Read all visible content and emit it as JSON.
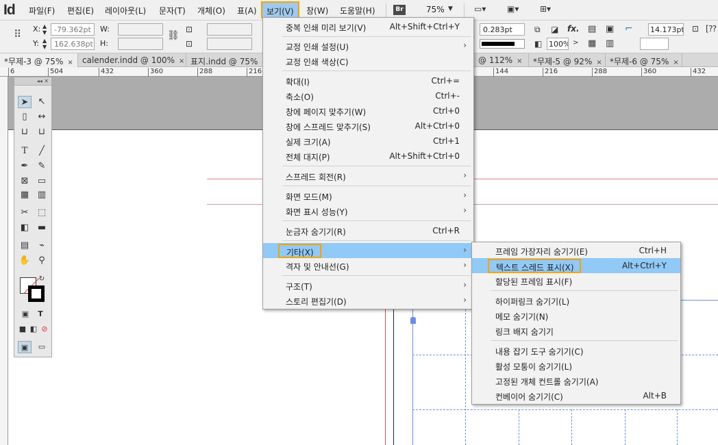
{
  "app": {
    "logo": "Id"
  },
  "menubar": {
    "items": [
      "파일(F)",
      "편집(E)",
      "레이아웃(L)",
      "문자(T)",
      "개체(O)",
      "표(A)",
      "보기(V)",
      "창(W)",
      "도움말(H)"
    ],
    "bridge_label": "Br",
    "zoom": "75%"
  },
  "control_panel": {
    "x_label": "X:",
    "x_value": "-79.362pt",
    "y_label": "Y:",
    "y_value": "162.638pt",
    "w_label": "W:",
    "h_label": "H:",
    "stroke_weight": "0.283pt",
    "opacity": "100%",
    "fx_label": "fx.",
    "size_value": "14.173pt"
  },
  "tabs": [
    {
      "label": "*무제-3 @ 75%",
      "close": "×"
    },
    {
      "label": "calender.indd @ 100%",
      "close": "×"
    },
    {
      "label": "표지.indd @ 75%",
      "close": ""
    },
    {
      "label": "@ 112%",
      "close": "×"
    },
    {
      "label": "*무제-5 @ 92%",
      "close": "×"
    },
    {
      "label": "*무제-6 @ 75%",
      "close": "×"
    }
  ],
  "ruler": {
    "ticks_left": [
      "6",
      "504",
      "432",
      "360",
      "288",
      "216"
    ],
    "ticks_right": [
      "144",
      "216",
      "288",
      "360",
      "432"
    ]
  },
  "view_menu": {
    "items": [
      {
        "label": "중복 인쇄 미리 보기(V)",
        "shortcut": "Alt+Shift+Ctrl+Y"
      },
      {
        "label": "교정 인쇄 설정(U)",
        "submenu": true
      },
      {
        "label": "교정 인쇄 색상(C)"
      },
      {
        "label": "확대(I)",
        "shortcut": "Ctrl+="
      },
      {
        "label": "축소(O)",
        "shortcut": "Ctrl+-"
      },
      {
        "label": "창에 페이지 맞추기(W)",
        "shortcut": "Ctrl+0"
      },
      {
        "label": "창에 스프레드 맞추기(S)",
        "shortcut": "Alt+Ctrl+0"
      },
      {
        "label": "실제 크기(A)",
        "shortcut": "Ctrl+1"
      },
      {
        "label": "전체 대지(P)",
        "shortcut": "Alt+Shift+Ctrl+0"
      },
      {
        "label": "스프레드 회전(R)",
        "submenu": true
      },
      {
        "label": "화면 모드(M)",
        "submenu": true
      },
      {
        "label": "화면 표시 성능(Y)",
        "submenu": true
      },
      {
        "label": "눈금자 숨기기(R)",
        "shortcut": "Ctrl+R"
      },
      {
        "label": "기타(X)",
        "submenu": true
      },
      {
        "label": "격자 및 안내선(G)",
        "submenu": true
      },
      {
        "label": "구조(T)",
        "submenu": true
      },
      {
        "label": "스토리 편집기(D)",
        "submenu": true
      }
    ]
  },
  "other_submenu": {
    "items": [
      {
        "label": "프레임 가장자리 숨기기(E)",
        "shortcut": "Ctrl+H"
      },
      {
        "label": "텍스트 스레드 표시(X)",
        "shortcut": "Alt+Ctrl+Y"
      },
      {
        "label": "할당된 프레임 표시(F)"
      },
      {
        "label": "하이퍼링크 숨기기(L)"
      },
      {
        "label": "메모 숨기기(N)"
      },
      {
        "label": "링크 배지 숨기기"
      },
      {
        "label": "내용 잡기 도구 숨기기(C)"
      },
      {
        "label": "활성 모퉁이 숨기기(L)"
      },
      {
        "label": "고정된 개체 컨트롤 숨기기(A)"
      },
      {
        "label": "컨베이어 숨기기(C)",
        "shortcut": "Alt+B"
      }
    ]
  },
  "colors": {
    "highlight": "#91c9f7",
    "callout": "#f5a300"
  }
}
